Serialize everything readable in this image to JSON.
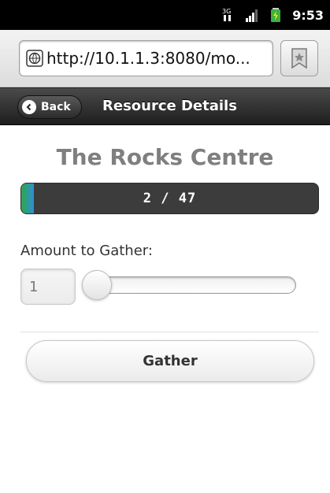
{
  "status_bar": {
    "time": "9:53",
    "icons": [
      "network-3g-icon",
      "signal-strength-icon",
      "battery-charging-icon"
    ]
  },
  "browser": {
    "url": "http://10.1.1.3:8080/mo...",
    "icons": [
      "globe-icon",
      "bookmark-star-icon"
    ]
  },
  "header": {
    "back_label": "Back",
    "title": "Resource Details"
  },
  "resource": {
    "name": "The Rocks Centre",
    "progress_label": "2 / 47",
    "progress_current": 2,
    "progress_total": 47
  },
  "gather_form": {
    "amount_label": "Amount to Gather:",
    "amount_value": "1",
    "slider_value": 1,
    "gather_button_label": "Gather"
  },
  "colors": {
    "progress_fill_start": "#2fa64a",
    "progress_fill_end": "#2d8fd8",
    "header_bg": "#2b2b2b",
    "title_gray": "#7f7f7f"
  }
}
